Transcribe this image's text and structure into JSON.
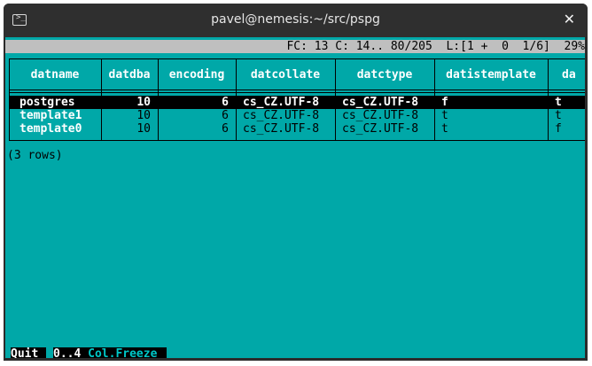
{
  "window": {
    "title": "pavel@nemesis:~/src/pspg"
  },
  "statusbar": {
    "text": "FC: 13 C: 14.. 80/205  L:[1 +  0  1/6]  29%"
  },
  "columns": [
    "datname",
    "datdba",
    "encoding",
    "datcollate",
    "datctype",
    "datistemplate",
    "da"
  ],
  "rows": [
    [
      "postgres",
      "10",
      "6",
      "cs_CZ.UTF-8",
      "cs_CZ.UTF-8",
      "f",
      "t"
    ],
    [
      "template1",
      "10",
      "6",
      "cs_CZ.UTF-8",
      "cs_CZ.UTF-8",
      "t",
      "t"
    ],
    [
      "template0",
      "10",
      "6",
      "cs_CZ.UTF-8",
      "cs_CZ.UTF-8",
      "t",
      "f"
    ]
  ],
  "footer_text": "(3 rows)",
  "keys": [
    {
      "key": "Quit",
      "desc": ""
    },
    {
      "key": "0..4",
      "desc": "Col.Freeze"
    }
  ],
  "icons": {
    "terminal": "terminal-icon",
    "close": "close-icon"
  }
}
